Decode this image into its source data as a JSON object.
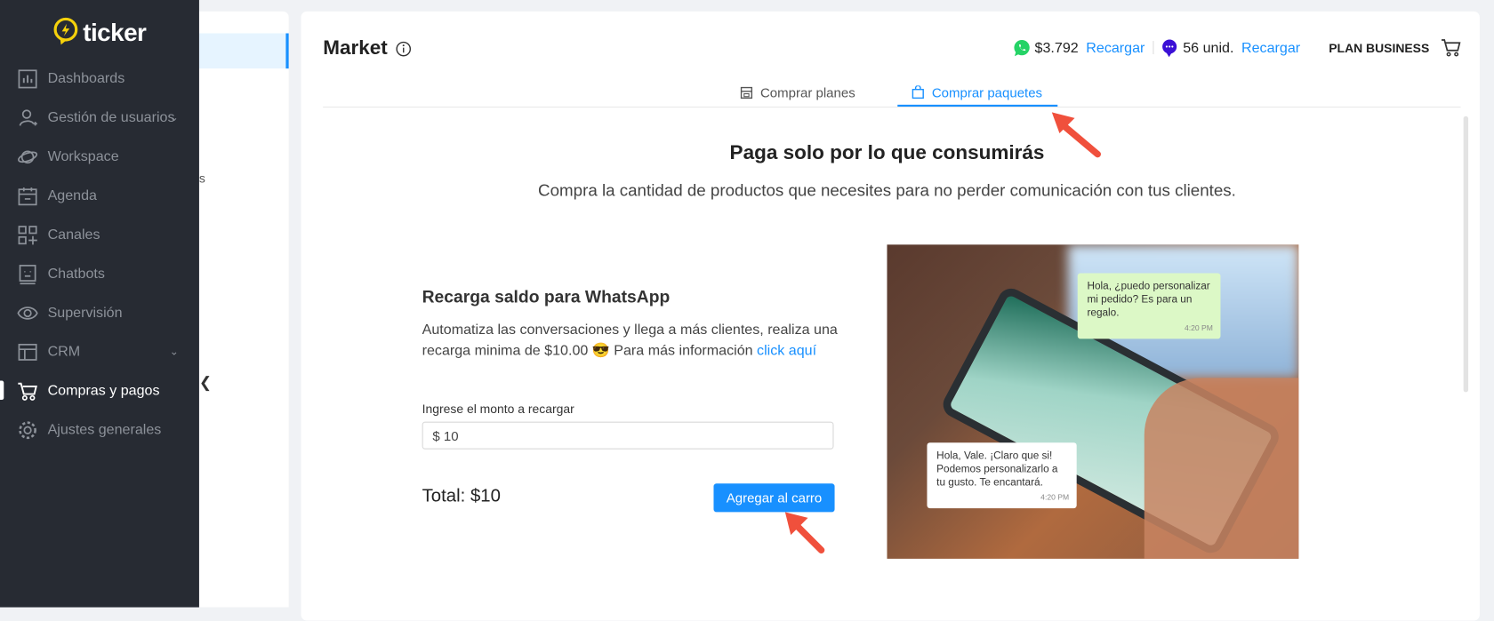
{
  "brand": {
    "name": "ticker",
    "accent": "#f5d10b"
  },
  "sidebar": {
    "items": [
      {
        "label": "Dashboards",
        "icon": "bar-chart-icon"
      },
      {
        "label": "Gestión de usuarios",
        "icon": "users-icon",
        "has_submenu": true
      },
      {
        "label": "Workspace",
        "icon": "planet-icon"
      },
      {
        "label": "Agenda",
        "icon": "calendar-icon"
      },
      {
        "label": "Canales",
        "icon": "apps-add-icon"
      },
      {
        "label": "Chatbots",
        "icon": "robot-icon"
      },
      {
        "label": "Supervisión",
        "icon": "eye-icon"
      },
      {
        "label": "CRM",
        "icon": "layout-icon",
        "has_submenu": true
      },
      {
        "label": "Compras y pagos",
        "icon": "cart-icon",
        "active": true
      },
      {
        "label": "Ajustes generales",
        "icon": "gear-icon"
      }
    ]
  },
  "subpanel": {
    "partial_text": "s",
    "collapse_glyph": "❮"
  },
  "header": {
    "title": "Market",
    "whatsapp_balance": "$3.792",
    "recharge_1": "Recargar",
    "sms_units": "56 unid.",
    "recharge_2": "Recargar",
    "plan": "PLAN BUSINESS"
  },
  "tabs": [
    {
      "label": "Comprar planes",
      "icon": "store-icon"
    },
    {
      "label": "Comprar paquetes",
      "icon": "bag-icon",
      "active": true
    }
  ],
  "hero": {
    "title": "Paga solo por lo que consumirás",
    "subtitle": "Compra la cantidad de productos que necesites para no perder comunicación con tus clientes."
  },
  "recharge": {
    "title": "Recarga saldo para WhatsApp",
    "description": "Automatiza las conversaciones y llega a más clientes, realiza una recarga minima de $10.00 😎 Para más información ",
    "link": "click aquí",
    "field_label": "Ingrese el monto a recargar",
    "amount_value": "$ 10",
    "total": "Total: $10",
    "add_button": "Agregar al carro"
  },
  "image_bubbles": {
    "customer": "Hola, ¿puedo personalizar mi pedido? Es para un regalo.",
    "customer_time": "4:20 PM",
    "reply": "Hola, Vale. ¡Claro que si! Podemos personalizarlo a tu gusto. Te encantará.",
    "reply_time": "4:20 PM"
  },
  "colors": {
    "primary": "#1890ff",
    "sidebar": "#272b33",
    "whatsapp": "#25d366",
    "sms": "#3b10d6",
    "annotation": "#f0503c"
  }
}
